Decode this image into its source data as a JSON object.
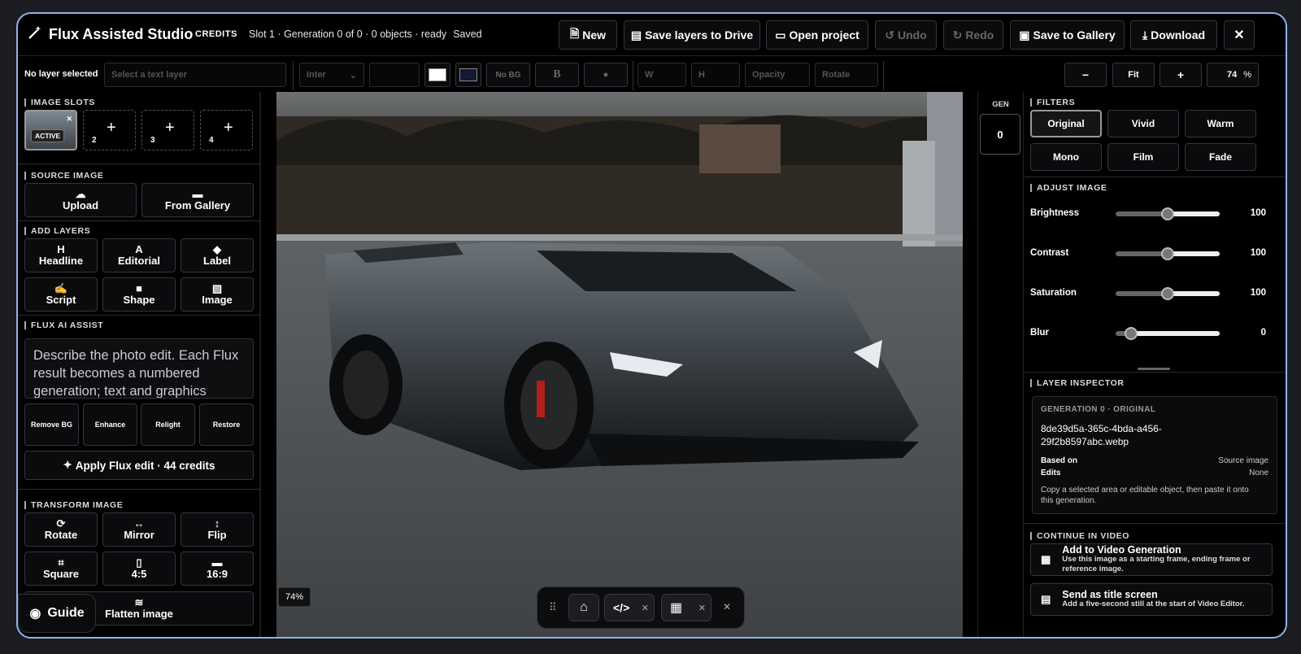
{
  "app": {
    "title": "Flux Assisted Studio",
    "credits_label": "CREDITS",
    "status": "Slot 1 · Generation 0 of 0 · 0 objects · ready",
    "saved": "Saved"
  },
  "topbar": {
    "new": "New",
    "save_layers": "Save layers to Drive",
    "open_project": "Open project",
    "undo": "Undo",
    "redo": "Redo",
    "save_gallery": "Save to Gallery",
    "download": "Download",
    "close": "✕"
  },
  "toolbar": {
    "layer_status": "No layer selected",
    "text_layer_placeholder": "Select a text layer",
    "font": "Inter",
    "nobg": "No BG",
    "bold": "B",
    "w": "W",
    "h": "H",
    "opacity": "Opacity",
    "rotate": "Rotate",
    "zoom_out": "−",
    "fit": "Fit",
    "zoom_in": "+",
    "zoom_value": "74",
    "zoom_unit": "%",
    "text_color": "#ffffff",
    "bg_color": "#121a33"
  },
  "left": {
    "image_slots_title": "IMAGE SLOTS",
    "slots": [
      {
        "label": "ACTIVE"
      },
      {
        "num": "2"
      },
      {
        "num": "3"
      },
      {
        "num": "4"
      }
    ],
    "source_title": "SOURCE IMAGE",
    "upload": "Upload",
    "from_gallery": "From Gallery",
    "add_layers_title": "ADD LAYERS",
    "layers": [
      "Headline",
      "Editorial",
      "Label",
      "Script",
      "Shape",
      "Image"
    ],
    "flux_title": "FLUX AI ASSIST",
    "prompt_placeholder": "Describe the photo edit. Each Flux result becomes a numbered generation; text and graphics",
    "flux_actions": [
      "Remove BG",
      "Enhance",
      "Relight",
      "Restore"
    ],
    "apply": "Apply Flux edit · 44 credits",
    "transform_title": "TRANSFORM IMAGE",
    "transforms": [
      "Rotate",
      "Mirror",
      "Flip",
      "Square",
      "4:5",
      "16:9"
    ],
    "flatten": "Flatten image",
    "guide": "Guide"
  },
  "canvas": {
    "zoom_tag": "74%"
  },
  "gen": {
    "label": "GEN",
    "value": "0"
  },
  "right": {
    "filters_title": "FILTERS",
    "filters": [
      "Original",
      "Vivid",
      "Warm",
      "Mono",
      "Film",
      "Fade"
    ],
    "adjust_title": "ADJUST IMAGE",
    "adjust": [
      {
        "name": "Brightness",
        "value": "100",
        "level": 0.5
      },
      {
        "name": "Contrast",
        "value": "100",
        "level": 0.5
      },
      {
        "name": "Saturation",
        "value": "100",
        "level": 0.5
      },
      {
        "name": "Blur",
        "value": "0",
        "level": 0.15
      }
    ],
    "inspector_title": "LAYER INSPECTOR",
    "gen_heading": "GENERATION 0 · ORIGINAL",
    "filename": "8de39d5a-365c-4bda-a456-29f2b8597abc.webp",
    "based_on_label": "Based on",
    "based_on": "Source image",
    "edits_label": "Edits",
    "edits": "None",
    "note": "Copy a selected area or editable object, then paste it onto this generation.",
    "video_title": "CONTINUE IN VIDEO",
    "video_add_title": "Add to Video Generation",
    "video_add_desc": "Use this image as a starting frame, ending frame or reference image.",
    "video_title_screen": "Send as title screen",
    "video_title_desc": "Add a five-second still at the start of Video Editor."
  }
}
